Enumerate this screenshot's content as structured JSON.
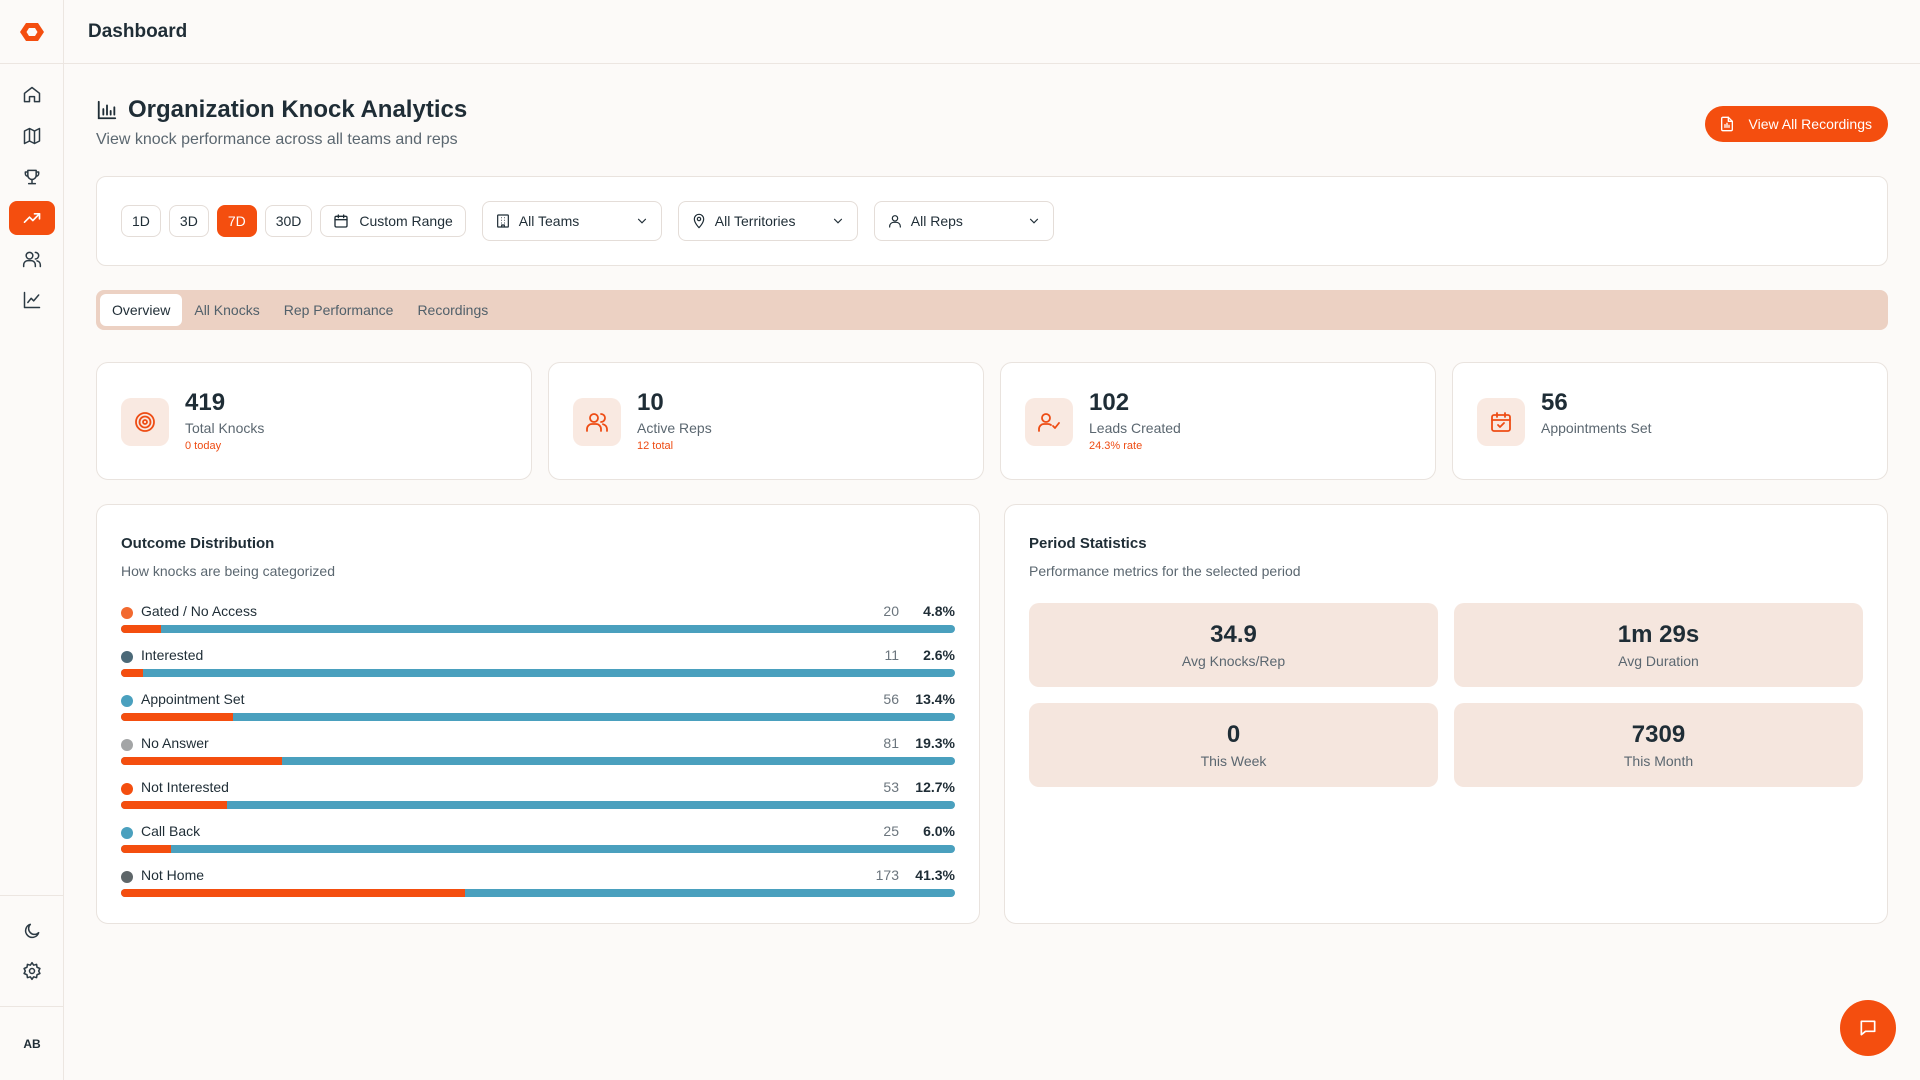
{
  "topbar": {
    "title": "Dashboard"
  },
  "header": {
    "title": "Organization Knock Analytics",
    "subtitle": "View knock performance across all teams and reps",
    "view_recordings_label": "View All Recordings"
  },
  "filters": {
    "ranges": [
      "1D",
      "3D",
      "7D",
      "30D"
    ],
    "active_range": "7D",
    "custom_range_label": "Custom Range",
    "teams": "All Teams",
    "territories": "All Territories",
    "reps": "All Reps"
  },
  "tabs": [
    "Overview",
    "All Knocks",
    "Rep Performance",
    "Recordings"
  ],
  "active_tab": "Overview",
  "stats": [
    {
      "value": "419",
      "label": "Total Knocks",
      "sub": "0 today",
      "icon": "target-icon"
    },
    {
      "value": "10",
      "label": "Active Reps",
      "sub": "12 total",
      "icon": "users-icon"
    },
    {
      "value": "102",
      "label": "Leads Created",
      "sub": "24.3% rate",
      "icon": "user-check-icon"
    },
    {
      "value": "56",
      "label": "Appointments Set",
      "sub": "",
      "icon": "calendar-check-icon"
    }
  ],
  "outcome": {
    "title": "Outcome Distribution",
    "subtitle": "How knocks are being categorized",
    "items": [
      {
        "label": "Gated / No Access",
        "count": "20",
        "pct": "4.8%",
        "fraction": 0.048,
        "color": "#f2692f"
      },
      {
        "label": "Interested",
        "count": "11",
        "pct": "2.6%",
        "fraction": 0.026,
        "color": "#4b6978"
      },
      {
        "label": "Appointment Set",
        "count": "56",
        "pct": "13.4%",
        "fraction": 0.134,
        "color": "#4aa0be"
      },
      {
        "label": "No Answer",
        "count": "81",
        "pct": "19.3%",
        "fraction": 0.193,
        "color": "#a3a5a6"
      },
      {
        "label": "Not Interested",
        "count": "53",
        "pct": "12.7%",
        "fraction": 0.127,
        "color": "#f44e0f"
      },
      {
        "label": "Call Back",
        "count": "25",
        "pct": "6.0%",
        "fraction": 0.06,
        "color": "#4aa0be"
      },
      {
        "label": "Not Home",
        "count": "173",
        "pct": "41.3%",
        "fraction": 0.413,
        "color": "#5e6669"
      }
    ]
  },
  "period": {
    "title": "Period Statistics",
    "subtitle": "Performance metrics for the selected period",
    "tiles": [
      {
        "value": "34.9",
        "label": "Avg Knocks/Rep"
      },
      {
        "value": "1m 29s",
        "label": "Avg Duration"
      },
      {
        "value": "0",
        "label": "This Week"
      },
      {
        "value": "7309",
        "label": "This Month"
      }
    ]
  },
  "user": {
    "initials": "AB"
  },
  "colors": {
    "accent": "#f44e0f",
    "bar_track": "#4aa0be",
    "tab_bg": "#ecd1c3",
    "tile_bg": "#f5e6de"
  }
}
